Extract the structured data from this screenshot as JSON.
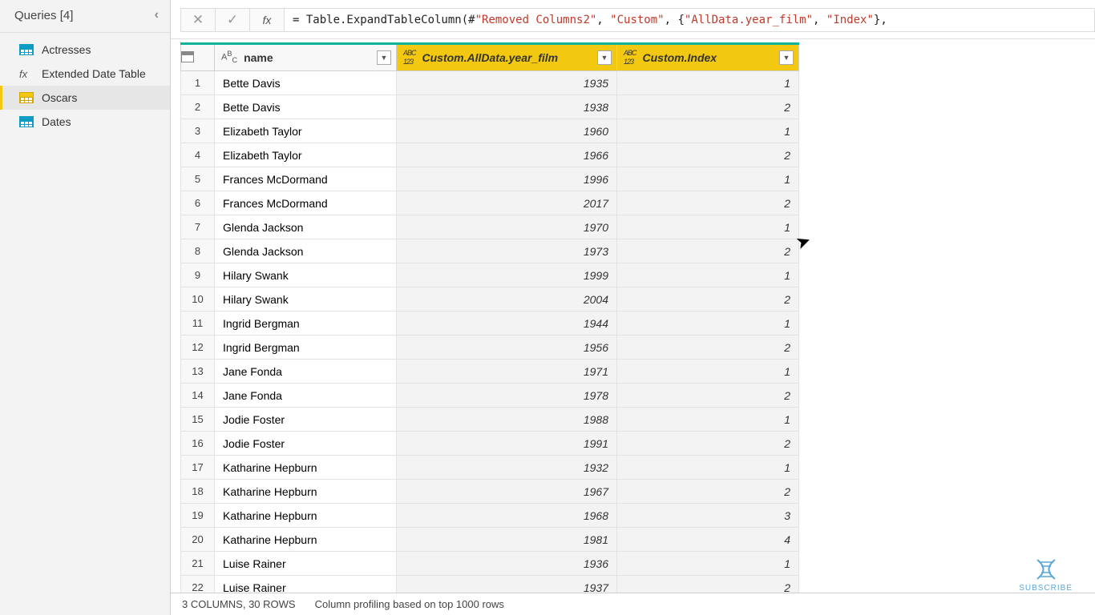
{
  "sidebar": {
    "title": "Queries [4]",
    "items": [
      {
        "label": "Actresses",
        "type": "table"
      },
      {
        "label": "Extended Date Table",
        "type": "fx"
      },
      {
        "label": "Oscars",
        "type": "table",
        "selected": true
      },
      {
        "label": "Dates",
        "type": "table"
      }
    ]
  },
  "formula": {
    "prefix": "= Table.ExpandTableColumn(#",
    "s1": "\"Removed Columns2\"",
    "m1": ", ",
    "s2": "\"Custom\"",
    "m2": ", {",
    "s3": "\"AllData.year_film\"",
    "m3": ", ",
    "s4": "\"Index\"",
    "suffix": "},"
  },
  "columns": {
    "c1": "name",
    "c2": "Custom.AllData.year_film",
    "c3": "Custom.Index"
  },
  "rows": [
    {
      "n": "1",
      "name": "Bette Davis",
      "year": "1935",
      "idx": "1"
    },
    {
      "n": "2",
      "name": "Bette Davis",
      "year": "1938",
      "idx": "2"
    },
    {
      "n": "3",
      "name": "Elizabeth Taylor",
      "year": "1960",
      "idx": "1"
    },
    {
      "n": "4",
      "name": "Elizabeth Taylor",
      "year": "1966",
      "idx": "2"
    },
    {
      "n": "5",
      "name": "Frances McDormand",
      "year": "1996",
      "idx": "1"
    },
    {
      "n": "6",
      "name": "Frances McDormand",
      "year": "2017",
      "idx": "2"
    },
    {
      "n": "7",
      "name": "Glenda Jackson",
      "year": "1970",
      "idx": "1"
    },
    {
      "n": "8",
      "name": "Glenda Jackson",
      "year": "1973",
      "idx": "2"
    },
    {
      "n": "9",
      "name": "Hilary Swank",
      "year": "1999",
      "idx": "1"
    },
    {
      "n": "10",
      "name": "Hilary Swank",
      "year": "2004",
      "idx": "2"
    },
    {
      "n": "11",
      "name": "Ingrid Bergman",
      "year": "1944",
      "idx": "1"
    },
    {
      "n": "12",
      "name": "Ingrid Bergman",
      "year": "1956",
      "idx": "2"
    },
    {
      "n": "13",
      "name": "Jane Fonda",
      "year": "1971",
      "idx": "1"
    },
    {
      "n": "14",
      "name": "Jane Fonda",
      "year": "1978",
      "idx": "2"
    },
    {
      "n": "15",
      "name": "Jodie Foster",
      "year": "1988",
      "idx": "1"
    },
    {
      "n": "16",
      "name": "Jodie Foster",
      "year": "1991",
      "idx": "2"
    },
    {
      "n": "17",
      "name": "Katharine Hepburn",
      "year": "1932",
      "idx": "1"
    },
    {
      "n": "18",
      "name": "Katharine Hepburn",
      "year": "1967",
      "idx": "2"
    },
    {
      "n": "19",
      "name": "Katharine Hepburn",
      "year": "1968",
      "idx": "3"
    },
    {
      "n": "20",
      "name": "Katharine Hepburn",
      "year": "1981",
      "idx": "4"
    },
    {
      "n": "21",
      "name": "Luise Rainer",
      "year": "1936",
      "idx": "1"
    },
    {
      "n": "22",
      "name": "Luise Rainer",
      "year": "1937",
      "idx": "2"
    }
  ],
  "status": {
    "cols_rows": "3 COLUMNS, 30 ROWS",
    "profiling": "Column profiling based on top 1000 rows"
  },
  "subscribe": "SUBSCRIBE"
}
